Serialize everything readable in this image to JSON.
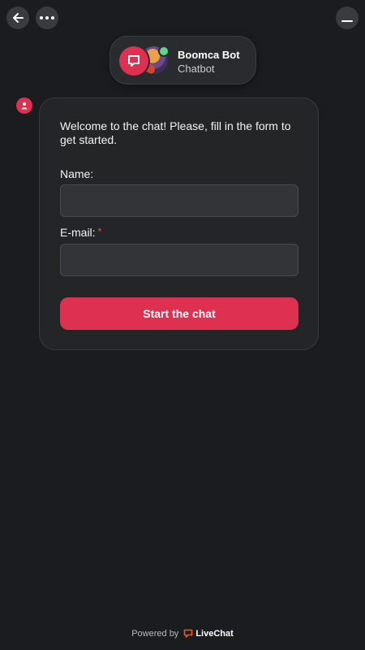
{
  "header": {
    "bot_name": "Boomca Bot",
    "bot_role": "Chatbot",
    "status": "online"
  },
  "icons": {
    "back": "arrow-left-icon",
    "more": "more-horizontal-icon",
    "minimize": "minimize-icon",
    "livechat": "livechat-logo-icon",
    "user": "user-icon"
  },
  "form": {
    "welcome_text": "Welcome to the chat! Please, fill in the form to get started.",
    "name_label": "Name:",
    "name_value": "",
    "email_label": "E-mail:",
    "email_required_marker": "*",
    "email_value": "",
    "submit_label": "Start the chat"
  },
  "footer": {
    "powered_by": "Powered by",
    "brand": "LiveChat"
  },
  "colors": {
    "background": "#1b1c20",
    "accent": "#de3050",
    "online": "#5fd48c",
    "required": "#e0573e"
  }
}
